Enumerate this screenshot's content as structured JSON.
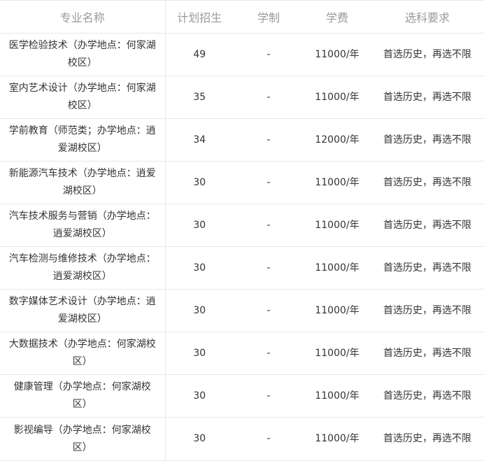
{
  "table": {
    "headers": [
      "专业名称",
      "计划招生",
      "学制",
      "学费",
      "选科要求"
    ],
    "rows": [
      {
        "name": "医学检验技术（办学地点：何家湖校区）",
        "count": "49",
        "years": "-",
        "fee": "11000/年",
        "requirement": "首选历史，再选不限"
      },
      {
        "name": "室内艺术设计（办学地点：何家湖校区）",
        "count": "35",
        "years": "-",
        "fee": "11000/年",
        "requirement": "首选历史，再选不限"
      },
      {
        "name": "学前教育（师范类；办学地点：逍爱湖校区）",
        "count": "34",
        "years": "-",
        "fee": "12000/年",
        "requirement": "首选历史，再选不限"
      },
      {
        "name": "新能源汽车技术（办学地点：逍爱湖校区）",
        "count": "30",
        "years": "-",
        "fee": "11000/年",
        "requirement": "首选历史，再选不限"
      },
      {
        "name": "汽车技术服务与营销（办学地点：逍爱湖校区）",
        "count": "30",
        "years": "-",
        "fee": "11000/年",
        "requirement": "首选历史，再选不限"
      },
      {
        "name": "汽车检测与维修技术（办学地点：逍爱湖校区）",
        "count": "30",
        "years": "-",
        "fee": "11000/年",
        "requirement": "首选历史，再选不限"
      },
      {
        "name": "数字媒体艺术设计（办学地点：逍爱湖校区）",
        "count": "30",
        "years": "-",
        "fee": "11000/年",
        "requirement": "首选历史，再选不限"
      },
      {
        "name": "大数据技术（办学地点：何家湖校区）",
        "count": "30",
        "years": "-",
        "fee": "11000/年",
        "requirement": "首选历史，再选不限"
      },
      {
        "name": "健康管理（办学地点：何家湖校区）",
        "count": "30",
        "years": "-",
        "fee": "11000/年",
        "requirement": "首选历史，再选不限"
      },
      {
        "name": "影视编导（办学地点：何家湖校区）",
        "count": "30",
        "years": "-",
        "fee": "11000/年",
        "requirement": "首选历史，再选不限"
      }
    ]
  }
}
